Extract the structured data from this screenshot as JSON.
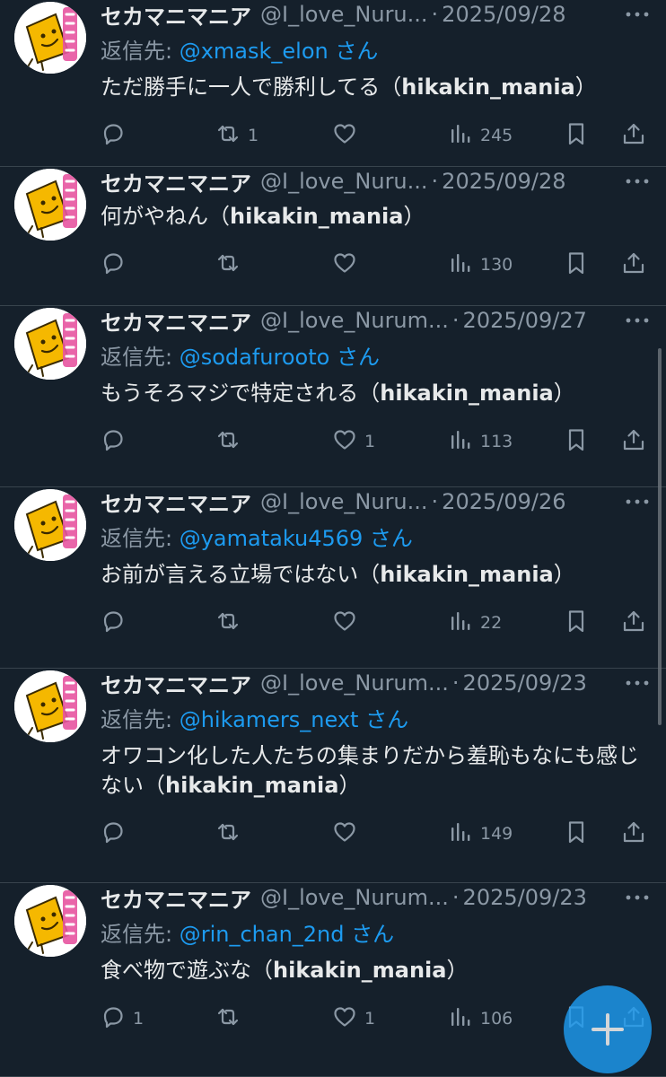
{
  "tweets": [
    {
      "name": "セカマニマニア",
      "handle": "@I_love_Nuru...",
      "date": "2025/09/28",
      "reply_prefix": "返信先: ",
      "reply_mention": "@xmask_elon",
      "reply_suffix": " さん",
      "text": "ただ勝手に一人で勝利してる（",
      "tag": "hikakin_mania",
      "text_end": "）",
      "replies": "",
      "retweets": "1",
      "likes": "",
      "views": "245"
    },
    {
      "name": "セカマニマニア",
      "handle": "@I_love_Nuru...",
      "date": "2025/09/28",
      "reply_prefix": "",
      "reply_mention": "",
      "reply_suffix": "",
      "text": "何がやねん（",
      "tag": "hikakin_mania",
      "text_end": "）",
      "replies": "",
      "retweets": "",
      "likes": "",
      "views": "130"
    },
    {
      "name": "セカマニマニア",
      "handle": "@I_love_Nurum...",
      "date": "2025/09/27",
      "reply_prefix": "返信先: ",
      "reply_mention": "@sodafurooto",
      "reply_suffix": " さん",
      "text": "もうそろマジで特定される（",
      "tag": "hikakin_mania",
      "text_end": "）",
      "replies": "",
      "retweets": "",
      "likes": "1",
      "views": "113"
    },
    {
      "name": "セカマニマニア",
      "handle": "@I_love_Nuru...",
      "date": "2025/09/26",
      "reply_prefix": "返信先: ",
      "reply_mention": "@yamataku4569",
      "reply_suffix": " さん",
      "text": "お前が言える立場ではない（",
      "tag": "hikakin_mania",
      "text_end": "）",
      "replies": "",
      "retweets": "",
      "likes": "",
      "views": "22"
    },
    {
      "name": "セカマニマニア",
      "handle": "@I_love_Nurum...",
      "date": "2025/09/23",
      "reply_prefix": "返信先: ",
      "reply_mention": "@hikamers_next",
      "reply_suffix": " さん",
      "text": "オワコン化した人たちの集まりだから羞恥もなにも感じない（",
      "tag": "hikakin_mania",
      "text_end": "）",
      "replies": "",
      "retweets": "",
      "likes": "",
      "views": "149"
    },
    {
      "name": "セカマニマニア",
      "handle": "@I_love_Nurum...",
      "date": "2025/09/23",
      "reply_prefix": "返信先: ",
      "reply_mention": "@rin_chan_2nd",
      "reply_suffix": " さん",
      "text": "食べ物で遊ぶな（",
      "tag": "hikakin_mania",
      "text_end": "）",
      "replies": "1",
      "retweets": "",
      "likes": "1",
      "views": "106"
    }
  ],
  "header_separator": "·",
  "icons": {
    "reply": "reply-icon",
    "retweet": "retweet-icon",
    "like": "heart-icon",
    "views": "views-icon",
    "bookmark": "bookmark-icon",
    "share": "share-icon",
    "more": "more-icon",
    "compose": "compose-plus-icon"
  },
  "colors": {
    "background": "#15202b",
    "divider": "#38444d",
    "text": "#e7e9ea",
    "muted": "#8b98a5",
    "accent": "#1d9bf0",
    "avatar_yellow": "#f5b800",
    "avatar_pink": "#e754a0"
  }
}
